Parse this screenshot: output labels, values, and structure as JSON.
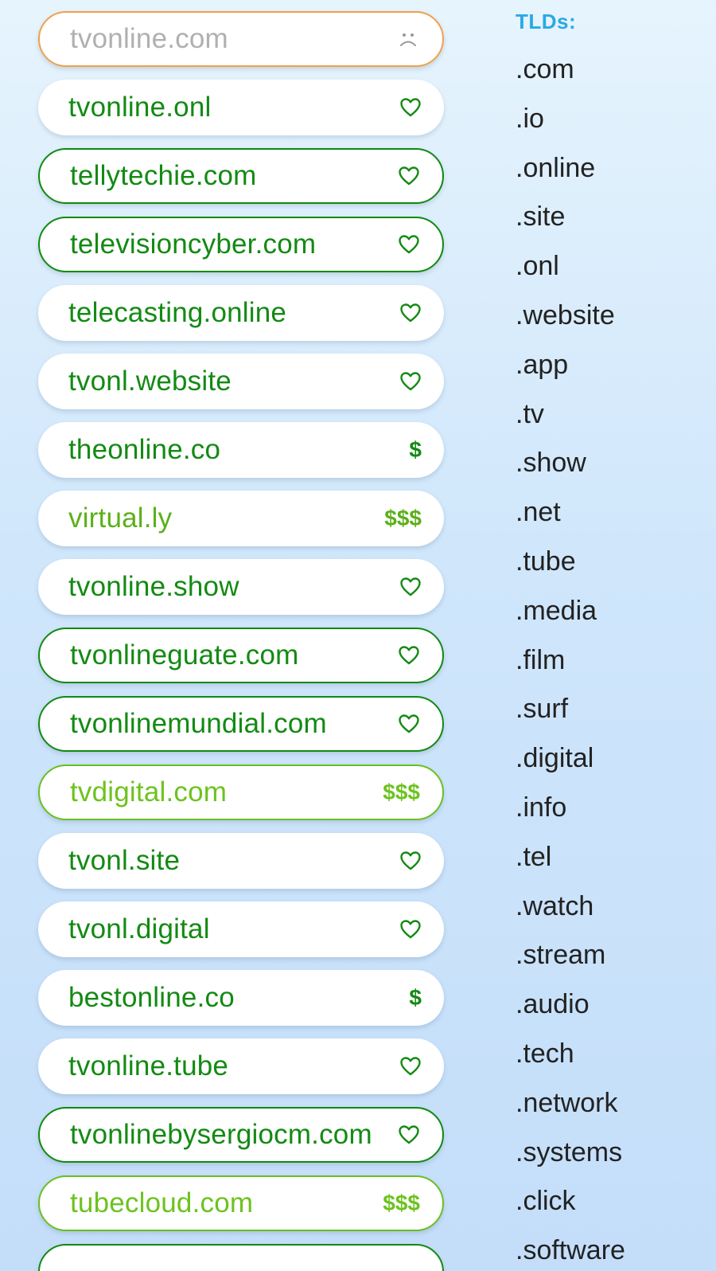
{
  "domains": [
    {
      "name": "tvonline.com",
      "status": "unavailable",
      "icon": "sad-face-icon",
      "variant": "unavailable"
    },
    {
      "name": "tvonline.onl",
      "status": "available",
      "icon": "heart-icon",
      "variant": "plain"
    },
    {
      "name": "tellytechie.com",
      "status": "available",
      "icon": "heart-icon",
      "variant": "bordered"
    },
    {
      "name": "televisioncyber.com",
      "status": "available",
      "icon": "heart-icon",
      "variant": "bordered"
    },
    {
      "name": "telecasting.online",
      "status": "available",
      "icon": "heart-icon",
      "variant": "plain"
    },
    {
      "name": "tvonl.website",
      "status": "available",
      "icon": "heart-icon",
      "variant": "plain"
    },
    {
      "name": "theonline.co",
      "status": "$",
      "icon": "",
      "variant": "plain"
    },
    {
      "name": "virtual.ly",
      "status": "$$$",
      "icon": "",
      "variant": "premium"
    },
    {
      "name": "tvonline.show",
      "status": "available",
      "icon": "heart-icon",
      "variant": "plain"
    },
    {
      "name": "tvonlineguate.com",
      "status": "available",
      "icon": "heart-icon",
      "variant": "bordered"
    },
    {
      "name": "tvonlinemundial.com",
      "status": "available",
      "icon": "heart-icon",
      "variant": "bordered"
    },
    {
      "name": "tvdigital.com",
      "status": "$$$",
      "icon": "",
      "variant": "light-bordered"
    },
    {
      "name": "tvonl.site",
      "status": "available",
      "icon": "heart-icon",
      "variant": "plain"
    },
    {
      "name": "tvonl.digital",
      "status": "available",
      "icon": "heart-icon",
      "variant": "plain"
    },
    {
      "name": "bestonline.co",
      "status": "$",
      "icon": "",
      "variant": "plain"
    },
    {
      "name": "tvonline.tube",
      "status": "available",
      "icon": "heart-icon",
      "variant": "plain"
    },
    {
      "name": "tvonlinebysergiocm.com",
      "status": "available",
      "icon": "heart-icon",
      "variant": "bordered"
    },
    {
      "name": "tubecloud.com",
      "status": "$$$",
      "icon": "",
      "variant": "light-bordered"
    },
    {
      "name": "",
      "status": "",
      "icon": "",
      "variant": "bordered"
    }
  ],
  "tld_heading": "TLDs:",
  "tlds": [
    ".com",
    ".io",
    ".online",
    ".site",
    ".onl",
    ".website",
    ".app",
    ".tv",
    ".show",
    ".net",
    ".tube",
    ".media",
    ".film",
    ".surf",
    ".digital",
    ".info",
    ".tel",
    ".watch",
    ".stream",
    ".audio",
    ".tech",
    ".network",
    ".systems",
    ".click",
    ".software"
  ],
  "colors": {
    "available_green": "#138a13",
    "premium_green": "#5cb01a",
    "unavailable_border": "#f2a04a",
    "tld_heading": "#2aa8e6"
  }
}
